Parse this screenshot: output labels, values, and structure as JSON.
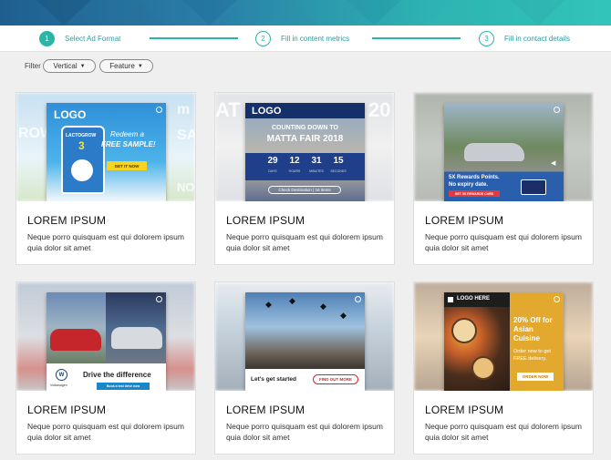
{
  "stepper": {
    "steps": [
      {
        "num": "1",
        "label": "Select Ad Format"
      },
      {
        "num": "2",
        "label": "Fill in content metrics"
      },
      {
        "num": "3",
        "label": "Fill in contact details"
      }
    ]
  },
  "filter": {
    "label": "Filter",
    "vertical_label": "Vertical",
    "feature_label": "Feature"
  },
  "colors": {
    "accent": "#2bb5a6",
    "banner_start": "#1f5f8f",
    "banner_end": "#32c4ba"
  },
  "cards": [
    {
      "title": "LOREM IPSUM",
      "desc": "Neque porro quisquam est qui dolorem ipsum quia dolor sit amet",
      "ad": {
        "logo": "LOGO",
        "line1": "Redeem a",
        "line2": "FREE SAMPLE!",
        "cta": "GET IT NOW",
        "product": "LACTOGROW",
        "product_num": "3",
        "bg_text1": "ROW",
        "bg_text2": "m",
        "bg_text3": "SAI",
        "bg_text4": "NOV"
      }
    },
    {
      "title": "LOREM IPSUM",
      "desc": "Neque porro quisquam est qui dolorem ipsum quia dolor sit amet",
      "ad": {
        "logo": "LOGO",
        "line1": "COUNTING DOWN TO",
        "line2": "MATTA FAIR 2018",
        "countdown": [
          {
            "val": "29",
            "unit": "DAYS"
          },
          {
            "val": "12",
            "unit": "HOURS"
          },
          {
            "val": "31",
            "unit": "MINUTES"
          },
          {
            "val": "15",
            "unit": "SECONDS"
          }
        ],
        "cta": "Check Destination | 16 items",
        "bg_text1": "AT",
        "bg_text2": "20"
      }
    },
    {
      "title": "LOREM IPSUM",
      "desc": "Neque porro quisquam est qui dolorem ipsum quia dolor sit amet",
      "ad": {
        "line1": "5X Rewards Points.",
        "line2": "No expiry date.",
        "cta": "GET 5X REWARDS CARD"
      }
    },
    {
      "title": "LOREM IPSUM",
      "desc": "Neque porro quisquam est qui dolorem ipsum quia dolor sit amet",
      "ad": {
        "brand": "Volkswagen",
        "line1": "Drive the difference",
        "cta": "Book a test drive now"
      }
    },
    {
      "title": "LOREM IPSUM",
      "desc": "Neque porro quisquam est qui dolorem ipsum quia dolor sit amet",
      "ad": {
        "line1": "Let's get started",
        "cta": "FIND OUT MORE"
      }
    },
    {
      "title": "LOREM IPSUM",
      "desc": "Neque porro quisquam est qui dolorem ipsum quia dolor sit amet",
      "ad": {
        "logo": "LOGO HERE",
        "line1": "20% Off for",
        "line2": "Asian",
        "line3": "Cuisine",
        "line4": "Order now to get",
        "line5": "FREE delivery.",
        "cta": "ORDER NOW"
      }
    }
  ]
}
